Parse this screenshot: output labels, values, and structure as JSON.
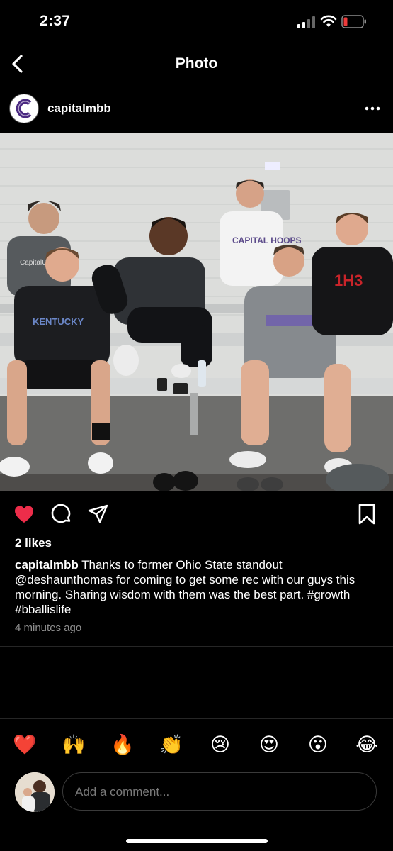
{
  "status": {
    "time": "2:37"
  },
  "nav": {
    "title": "Photo",
    "back_icon": "chevron-left-icon"
  },
  "post": {
    "username": "capitalmbb",
    "avatar_letter": "C",
    "more_icon": "ellipsis-icon",
    "photo_text": {
      "shirt1": "KENTUCKY",
      "shirt2": "CAPITAL HOOPS",
      "shirt3": "1H3",
      "shirt4": "CapitalUniv"
    },
    "liked": true,
    "likes": "2 likes",
    "caption_user": "capitalmbb",
    "caption_text": " Thanks to former Ohio State standout @deshaunthomas for coming to get some rec with our guys this morning.  Sharing wisdom with them was the best part. #growth #bballislife",
    "timestamp": "4 minutes ago"
  },
  "quick_reactions": [
    "❤️",
    "🙌",
    "🔥",
    "👏",
    "😢",
    "😍",
    "😮",
    "😂"
  ],
  "comment": {
    "placeholder": "Add a comment..."
  },
  "colors": {
    "like_red": "#ed2d4a",
    "background": "#000000",
    "avatar_purple": "#4b2a82"
  }
}
